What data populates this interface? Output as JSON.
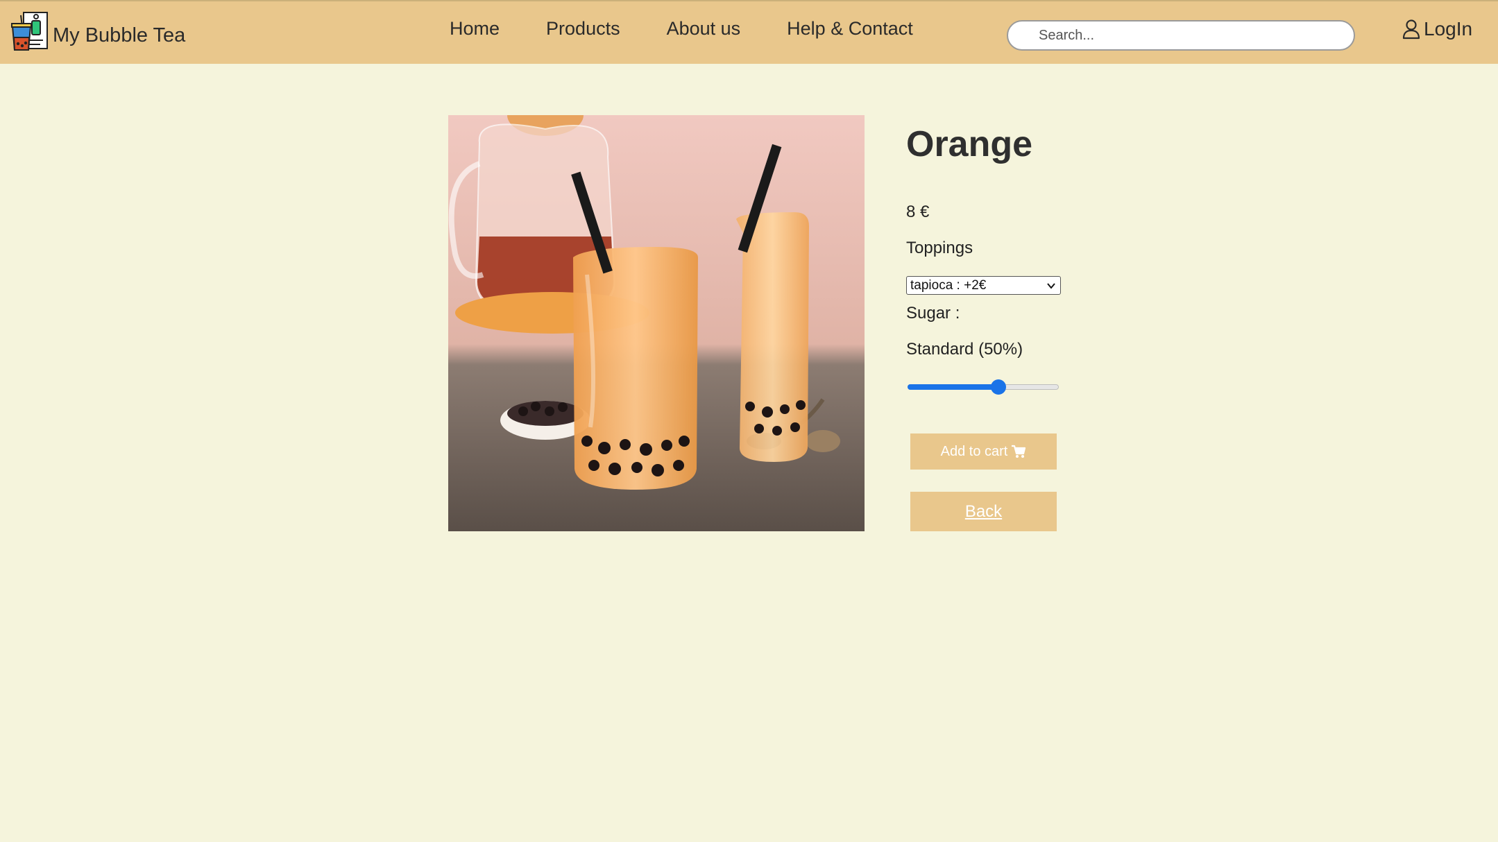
{
  "brand": {
    "name": "My Bubble Tea",
    "logo_icon": "bubble-tea-menu-logo-icon"
  },
  "nav": {
    "links": [
      "Home",
      "Products",
      "About us",
      "Help & Contact"
    ]
  },
  "search": {
    "placeholder": "Search...",
    "icon": "search-icon"
  },
  "login": {
    "label": "LogIn",
    "icon": "user-icon"
  },
  "product": {
    "name": "Orange",
    "price": "8 €",
    "image_icon": "bubble-tea-photo",
    "toppings": {
      "label": "Toppings",
      "selected": "tapioca : +2€"
    },
    "sugar": {
      "label": "Sugar :",
      "value_label": "Standard (50%)",
      "level": 0.6
    },
    "add_to_cart": {
      "label": "Add to cart",
      "icon": "cart-icon"
    },
    "back": {
      "label": "Back"
    }
  },
  "colors": {
    "background": "#f5f4dc",
    "navbar": "#e9c78c",
    "accent": "#1a73e8",
    "button_text": "#ffffff"
  }
}
